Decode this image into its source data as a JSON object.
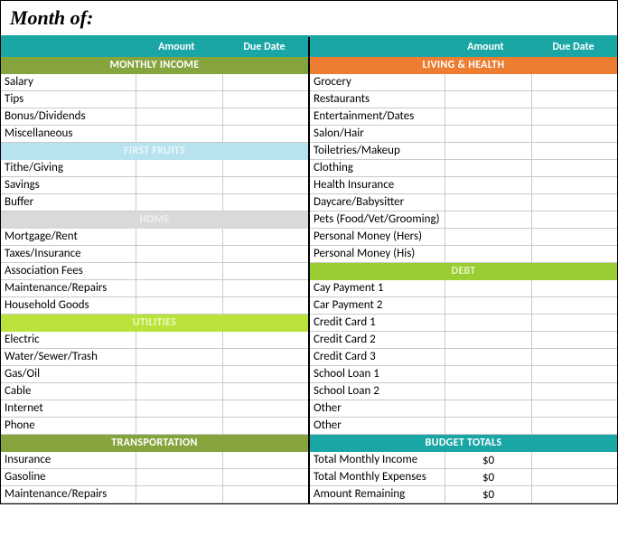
{
  "title": "Month of:",
  "headers": {
    "amount": "Amount",
    "due": "Due Date"
  },
  "left": {
    "sections": [
      {
        "title": "MONTHLY INCOME",
        "class": "bg-olive",
        "rows": [
          {
            "label": "Salary",
            "amount": "",
            "due": ""
          },
          {
            "label": "Tips",
            "amount": "",
            "due": ""
          },
          {
            "label": "Bonus/Dividends",
            "amount": "",
            "due": ""
          },
          {
            "label": "Miscellaneous",
            "amount": "",
            "due": ""
          }
        ]
      },
      {
        "title": "FIRST FRUITS",
        "class": "bg-lightblue",
        "rows": [
          {
            "label": "Tithe/Giving",
            "amount": "",
            "due": ""
          },
          {
            "label": "Savings",
            "amount": "",
            "due": ""
          },
          {
            "label": "Buffer",
            "amount": "",
            "due": ""
          }
        ]
      },
      {
        "title": "HOME",
        "class": "bg-gray",
        "rows": [
          {
            "label": "Mortgage/Rent",
            "amount": "",
            "due": ""
          },
          {
            "label": "Taxes/Insurance",
            "amount": "",
            "due": ""
          },
          {
            "label": "Association Fees",
            "amount": "",
            "due": ""
          },
          {
            "label": "Maintenance/Repairs",
            "amount": "",
            "due": ""
          },
          {
            "label": "Household Goods",
            "amount": "",
            "due": ""
          }
        ]
      },
      {
        "title": "UTILITIES",
        "class": "bg-lime",
        "rows": [
          {
            "label": "Electric",
            "amount": "",
            "due": ""
          },
          {
            "label": "Water/Sewer/Trash",
            "amount": "",
            "due": ""
          },
          {
            "label": "Gas/Oil",
            "amount": "",
            "due": ""
          },
          {
            "label": "Cable",
            "amount": "",
            "due": ""
          },
          {
            "label": "Internet",
            "amount": "",
            "due": ""
          },
          {
            "label": "Phone",
            "amount": "",
            "due": ""
          }
        ]
      },
      {
        "title": "TRANSPORTATION",
        "class": "bg-olive",
        "rows": [
          {
            "label": "Insurance",
            "amount": "",
            "due": ""
          },
          {
            "label": "Gasoline",
            "amount": "",
            "due": ""
          },
          {
            "label": "Maintenance/Repairs",
            "amount": "",
            "due": ""
          }
        ]
      }
    ]
  },
  "right": {
    "sections": [
      {
        "title": "LIVING & HEALTH",
        "class": "bg-orange",
        "rows": [
          {
            "label": "Grocery",
            "amount": "",
            "due": ""
          },
          {
            "label": "Restaurants",
            "amount": "",
            "due": ""
          },
          {
            "label": "Entertainment/Dates",
            "amount": "",
            "due": ""
          },
          {
            "label": "Salon/Hair",
            "amount": "",
            "due": ""
          },
          {
            "label": "Toiletries/Makeup",
            "amount": "",
            "due": ""
          },
          {
            "label": "Clothing",
            "amount": "",
            "due": ""
          },
          {
            "label": "Health Insurance",
            "amount": "",
            "due": ""
          },
          {
            "label": "Daycare/Babysitter",
            "amount": "",
            "due": ""
          },
          {
            "label": "Pets (Food/Vet/Grooming)",
            "amount": "",
            "due": ""
          },
          {
            "label": "Personal Money (Hers)",
            "amount": "",
            "due": ""
          },
          {
            "label": "Personal Money (His)",
            "amount": "",
            "due": ""
          }
        ]
      },
      {
        "title": "DEBT",
        "class": "bg-green2",
        "rows": [
          {
            "label": "Cay Payment 1",
            "amount": "",
            "due": ""
          },
          {
            "label": "Car Payment 2",
            "amount": "",
            "due": ""
          },
          {
            "label": "Credit Card 1",
            "amount": "",
            "due": ""
          },
          {
            "label": "Credit Card 2",
            "amount": "",
            "due": ""
          },
          {
            "label": "Credit Card 3",
            "amount": "",
            "due": ""
          },
          {
            "label": "School Loan 1",
            "amount": "",
            "due": ""
          },
          {
            "label": "School Loan 2",
            "amount": "",
            "due": ""
          },
          {
            "label": "Other",
            "amount": "",
            "due": ""
          },
          {
            "label": "Other",
            "amount": "",
            "due": ""
          }
        ]
      }
    ],
    "totals": {
      "title": "BUDGET TOTALS",
      "rows": [
        {
          "label": "Total Monthly Income",
          "amount": "$0",
          "due": ""
        },
        {
          "label": "Total Monthly Expenses",
          "amount": "$0",
          "due": ""
        },
        {
          "label": "Amount Remaining",
          "amount": "$0",
          "due": ""
        }
      ]
    }
  }
}
